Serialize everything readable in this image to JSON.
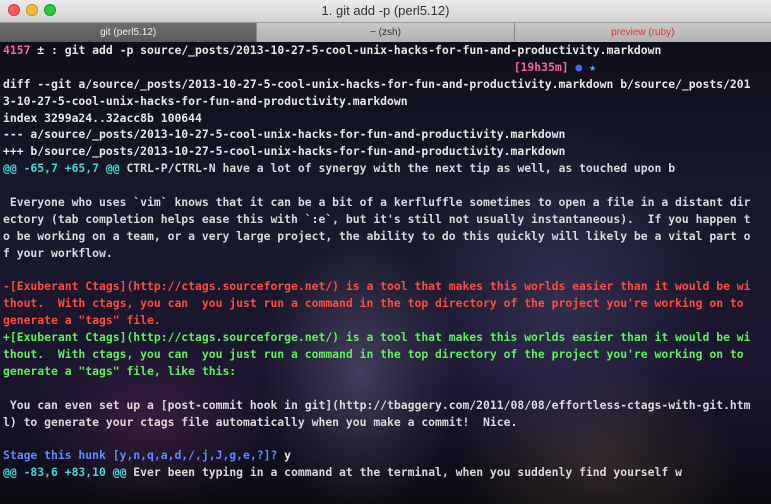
{
  "window": {
    "title": "1. git add -p  (perl5.12)"
  },
  "tabs": [
    {
      "label": "git (perl5.12)",
      "active": true
    },
    {
      "label": "~ (zsh)",
      "active": false
    },
    {
      "label": "preview (ruby)",
      "active": false
    }
  ],
  "terminal": {
    "prompt_num": "4157",
    "prompt_sym": " ± ",
    "prompt_cmd": ": git add -p source/_posts/2013-10-27-5-cool-unix-hacks-for-fun-and-productivity.markdown",
    "rprompt_time": "[19h35m]",
    "rprompt_dot": "●",
    "rprompt_star": "★",
    "diff_header": [
      "diff --git a/source/_posts/2013-10-27-5-cool-unix-hacks-for-fun-and-productivity.markdown b/source/_posts/201",
      "3-10-27-5-cool-unix-hacks-for-fun-and-productivity.markdown",
      "index 3299a24..32acc8b 100644",
      "--- a/source/_posts/2013-10-27-5-cool-unix-hacks-for-fun-and-productivity.markdown",
      "+++ b/source/_posts/2013-10-27-5-cool-unix-hacks-for-fun-and-productivity.markdown"
    ],
    "hunk1_marker": "@@ -65,7 +65,7 @@",
    "hunk1_ctx": " CTRL-P/CTRL-N have a lot of synergy with the next tip as well, as touched upon b",
    "context1": [
      "",
      " Everyone who uses `vim` knows that it can be a bit of a kerfluffle sometimes to open a file in a distant dir",
      "ectory (tab completion helps ease this with `:e`, but it's still not usually instantaneous).  If you happen t",
      "o be working on a team, or a very large project, the ability to do this quickly will likely be a vital part o",
      "f your workflow.",
      ""
    ],
    "removed": [
      "-[Exuberant Ctags](http://ctags.sourceforge.net/) is a tool that makes this worlds easier than it would be wi",
      "thout.  With ctags, you can  you just run a command in the top directory of the project you're working on to",
      "generate a \"tags\" file."
    ],
    "added": [
      "+[Exuberant Ctags](http://ctags.sourceforge.net/) is a tool that makes this worlds easier than it would be wi",
      "thout.  With ctags, you can  you just run a command in the top directory of the project you're working on to",
      "generate a \"tags\" file, like this:"
    ],
    "context2": [
      "",
      " You can even set up a [post-commit hook in git](http://tbaggery.com/2011/08/08/effortless-ctags-with-git.htm",
      "l) to generate your ctags file automatically when you make a commit!  Nice.",
      ""
    ],
    "stage_question": "Stage this hunk [y,n,q,a,d,/,j,J,g,e,?]?",
    "stage_answer": " y",
    "hunk2_marker": "@@ -83,6 +83,10 @@",
    "hunk2_ctx": " Ever been typing in a command at the terminal, when you suddenly find yourself w"
  }
}
